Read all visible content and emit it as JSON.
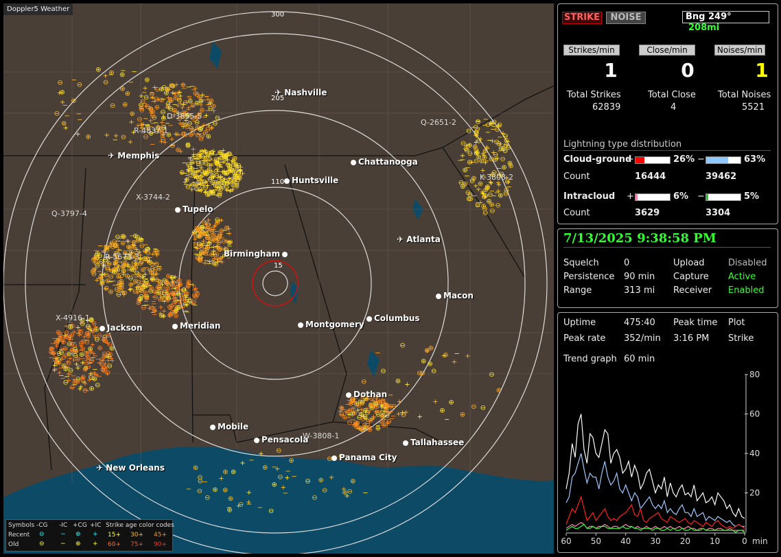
{
  "app_title": "Doppler5 Weather",
  "map": {
    "ring_labels": [
      "300",
      "205",
      "110",
      "15"
    ],
    "cities": [
      {
        "name": "Nashville",
        "icon": "airport-icon"
      },
      {
        "name": "Memphis",
        "icon": "airport-icon"
      },
      {
        "name": "Chattanooga",
        "icon": "dot-icon"
      },
      {
        "name": "Huntsville",
        "icon": "dot-icon"
      },
      {
        "name": "Tupelo",
        "icon": "dot-icon"
      },
      {
        "name": "Atlanta",
        "icon": "airport-icon"
      },
      {
        "name": "Birmingham",
        "icon": "dot-icon"
      },
      {
        "name": "Macon",
        "icon": "dot-icon"
      },
      {
        "name": "Jackson",
        "icon": "dot-icon"
      },
      {
        "name": "Meridian",
        "icon": "dot-icon"
      },
      {
        "name": "Montgomery",
        "icon": "dot-icon"
      },
      {
        "name": "Columbus",
        "icon": "dot-icon"
      },
      {
        "name": "Dothan",
        "icon": "dot-icon"
      },
      {
        "name": "Mobile",
        "icon": "dot-icon"
      },
      {
        "name": "Pensacola",
        "icon": "dot-icon"
      },
      {
        "name": "Tallahassee",
        "icon": "dot-icon"
      },
      {
        "name": "Panama City",
        "icon": "dot-icon"
      },
      {
        "name": "New Orleans",
        "icon": "airport-icon"
      }
    ],
    "storm_ids": [
      "D-3855-5",
      "R-4837-1",
      "Q-2651-2",
      "K-3808-2",
      "X-3744-2",
      "Q-3797-4",
      "R-5673-3",
      "X-4916-1",
      "W-3808-1"
    ]
  },
  "legend": {
    "symbols_label": "Symbols",
    "cols": [
      "-CG",
      "-IC",
      "+CG",
      "+IC"
    ],
    "age_label": "Strike age color codes",
    "recent_label": "Recent",
    "old_label": "Old",
    "recent_ages": [
      "15+",
      "30+",
      "45+"
    ],
    "old_ages": [
      "60+",
      "75+",
      "90+"
    ]
  },
  "counters": {
    "strike_button": "STRIKE",
    "noise_button": "NOISE",
    "bearing": "Bng 249°",
    "distance": "208mi",
    "strikes_min_label": "Strikes/min",
    "close_min_label": "Close/min",
    "noises_min_label": "Noises/min",
    "strikes_min": "1",
    "close_min": "0",
    "noises_min": "1",
    "total_strikes_label": "Total Strikes",
    "total_close_label": "Total Close",
    "total_noises_label": "Total Noises",
    "total_strikes": "62839",
    "total_close": "4",
    "total_noises": "5521",
    "dist_title": "Lightning type distribution",
    "cg_label": "Cloud-ground",
    "ic_label": "Intracloud",
    "count_label": "Count",
    "plus": "+",
    "minus": "−",
    "cg_pos_pct": "26%",
    "cg_neg_pct": "63%",
    "cg_pos_count": "16444",
    "cg_neg_count": "39462",
    "ic_pos_pct": "6%",
    "ic_neg_pct": "5%",
    "ic_pos_count": "3629",
    "ic_neg_count": "3304",
    "cg_pos_fill": 0.26,
    "cg_neg_fill": 0.63,
    "ic_pos_fill": 0.06,
    "ic_neg_fill": 0.05
  },
  "status": {
    "datetime": "7/13/2025 9:38:58 PM",
    "squelch_label": "Squelch",
    "squelch": "0",
    "persistence_label": "Persistence",
    "persistence": "90 min",
    "range_label": "Range",
    "range": "313 mi",
    "upload_label": "Upload",
    "upload": "Disabled",
    "capture_label": "Capture",
    "capture": "Active",
    "receiver_label": "Receiver",
    "receiver": "Enabled"
  },
  "stats": {
    "uptime_label": "Uptime",
    "uptime": "475:40",
    "peak_time_label": "Peak time",
    "peak_time": "3:16 PM",
    "plot_label": "Plot",
    "plot": "Strike",
    "peak_rate_label": "Peak rate",
    "peak_rate": "352/min",
    "trend_label": "Trend graph",
    "trend": "60 min"
  },
  "chart_data": {
    "type": "line",
    "x_ticks": [
      "60",
      "50",
      "40",
      "30",
      "20",
      "10",
      "0"
    ],
    "xlabel": "min",
    "y_ticks": [
      "20",
      "40",
      "60",
      "80"
    ],
    "ylim": [
      0,
      80
    ],
    "xlim": [
      60,
      0
    ],
    "series": [
      {
        "color": "#ffffff",
        "values": [
          22,
          30,
          45,
          38,
          55,
          60,
          42,
          35,
          50,
          48,
          40,
          38,
          45,
          52,
          50,
          35,
          40,
          42,
          38,
          30,
          32,
          36,
          28,
          34,
          30,
          22,
          25,
          30,
          32,
          26,
          20,
          24,
          22,
          28,
          18,
          25,
          20,
          18,
          22,
          24,
          19,
          20,
          18,
          24,
          16,
          18,
          20,
          15,
          16,
          18,
          14,
          20,
          18,
          16,
          12,
          14,
          10,
          8,
          12,
          8,
          7
        ]
      },
      {
        "color": "#a0c8ff",
        "values": [
          15,
          18,
          28,
          30,
          35,
          40,
          32,
          25,
          30,
          28,
          28,
          22,
          30,
          36,
          28,
          24,
          26,
          30,
          22,
          20,
          24,
          20,
          16,
          20,
          18,
          12,
          14,
          16,
          18,
          14,
          12,
          14,
          12,
          16,
          10,
          12,
          10,
          9,
          12,
          14,
          10,
          10,
          8,
          12,
          8,
          9,
          10,
          6,
          8,
          7,
          6,
          8,
          7,
          6,
          5,
          6,
          4,
          3,
          4,
          3,
          3
        ]
      },
      {
        "color": "#ff2020",
        "values": [
          4,
          8,
          12,
          10,
          14,
          18,
          12,
          6,
          8,
          10,
          6,
          8,
          10,
          12,
          8,
          6,
          7,
          6,
          8,
          9,
          10,
          12,
          14,
          9,
          8,
          12,
          6,
          5,
          7,
          8,
          9,
          10,
          7,
          6,
          5,
          8,
          7,
          6,
          5,
          6,
          7,
          5,
          4,
          6,
          5,
          4,
          3,
          5,
          4,
          3,
          5,
          6,
          4,
          3,
          2,
          3,
          2,
          3,
          4,
          3,
          2
        ]
      },
      {
        "color": "#ff80b0",
        "values": [
          2,
          3,
          4,
          3,
          4,
          5,
          4,
          2,
          3,
          3,
          2,
          3,
          3,
          4,
          3,
          2,
          3,
          3,
          2,
          3,
          4,
          3,
          3,
          2,
          3,
          2,
          2,
          3,
          2,
          2,
          3,
          2,
          2,
          3,
          2,
          3,
          2,
          2,
          3,
          2,
          2,
          3,
          2,
          2,
          1,
          2,
          2,
          1,
          2,
          2,
          1,
          2,
          2,
          1,
          1,
          2,
          1,
          1,
          1,
          1,
          1
        ]
      },
      {
        "color": "#30ff30",
        "values": [
          1,
          2,
          3,
          2,
          2,
          3,
          4,
          2,
          2,
          3,
          2,
          2,
          3,
          3,
          2,
          2,
          2,
          2,
          2,
          3,
          2,
          2,
          3,
          2,
          2,
          1,
          2,
          2,
          2,
          1,
          2,
          2,
          1,
          1,
          2,
          1,
          2,
          1,
          1,
          2,
          1,
          1,
          2,
          1,
          1,
          1,
          2,
          1,
          1,
          1,
          1,
          1,
          1,
          1,
          1,
          1,
          1,
          0,
          1,
          1,
          0
        ]
      }
    ]
  },
  "colors": {
    "accent": "#33ff33",
    "strike_border": "#cc0000",
    "noises": "#ffff00",
    "cg_pos": "#ff0000",
    "cg_neg": "#8ec8ff",
    "ic_pos": "#ff80b0",
    "ic_neg": "#20d020"
  }
}
